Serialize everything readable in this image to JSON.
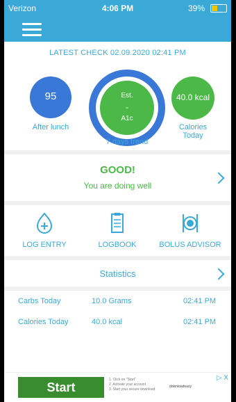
{
  "status": {
    "carrier": "Verizon",
    "time": "4:06 PM",
    "battery": "39%"
  },
  "header": {
    "latest_check": "LATEST CHECK 02.09.2020 02:41 PM"
  },
  "metrics": {
    "left": {
      "value": "95",
      "label": "After lunch"
    },
    "middle": {
      "line1": "Est.",
      "line2": "-",
      "line3": "A1c",
      "caption": "7 days trend"
    },
    "right": {
      "value": "40.0 kcal",
      "label_line1": "Calories",
      "label_line2": "Today"
    }
  },
  "status_banner": {
    "title": "GOOD!",
    "subtitle": "You are doing well"
  },
  "actions": [
    {
      "label": "LOG ENTRY",
      "icon": "drop-plus-icon"
    },
    {
      "label": "LOGBOOK",
      "icon": "clipboard-icon"
    },
    {
      "label": "BOLUS ADVISOR",
      "icon": "plate-utensils-icon"
    }
  ],
  "statistics": {
    "label": "Statistics"
  },
  "today_rows": [
    {
      "name": "Carbs Today",
      "value": "10.0 Grams",
      "time": "02:41 PM"
    },
    {
      "name": "Calories Today",
      "value": "40.0 kcal",
      "time": "02:41 PM"
    }
  ],
  "ad": {
    "cta": "Start",
    "steps": [
      "1. Click on \"Start\"",
      "2. Activate your account",
      "3. Start your secure download"
    ],
    "brand": "downloadeasy",
    "close": "▷ X"
  },
  "colors": {
    "primary": "#3aa9d8",
    "accent_green": "#4cb848",
    "accent_blue": "#3a78d8"
  }
}
